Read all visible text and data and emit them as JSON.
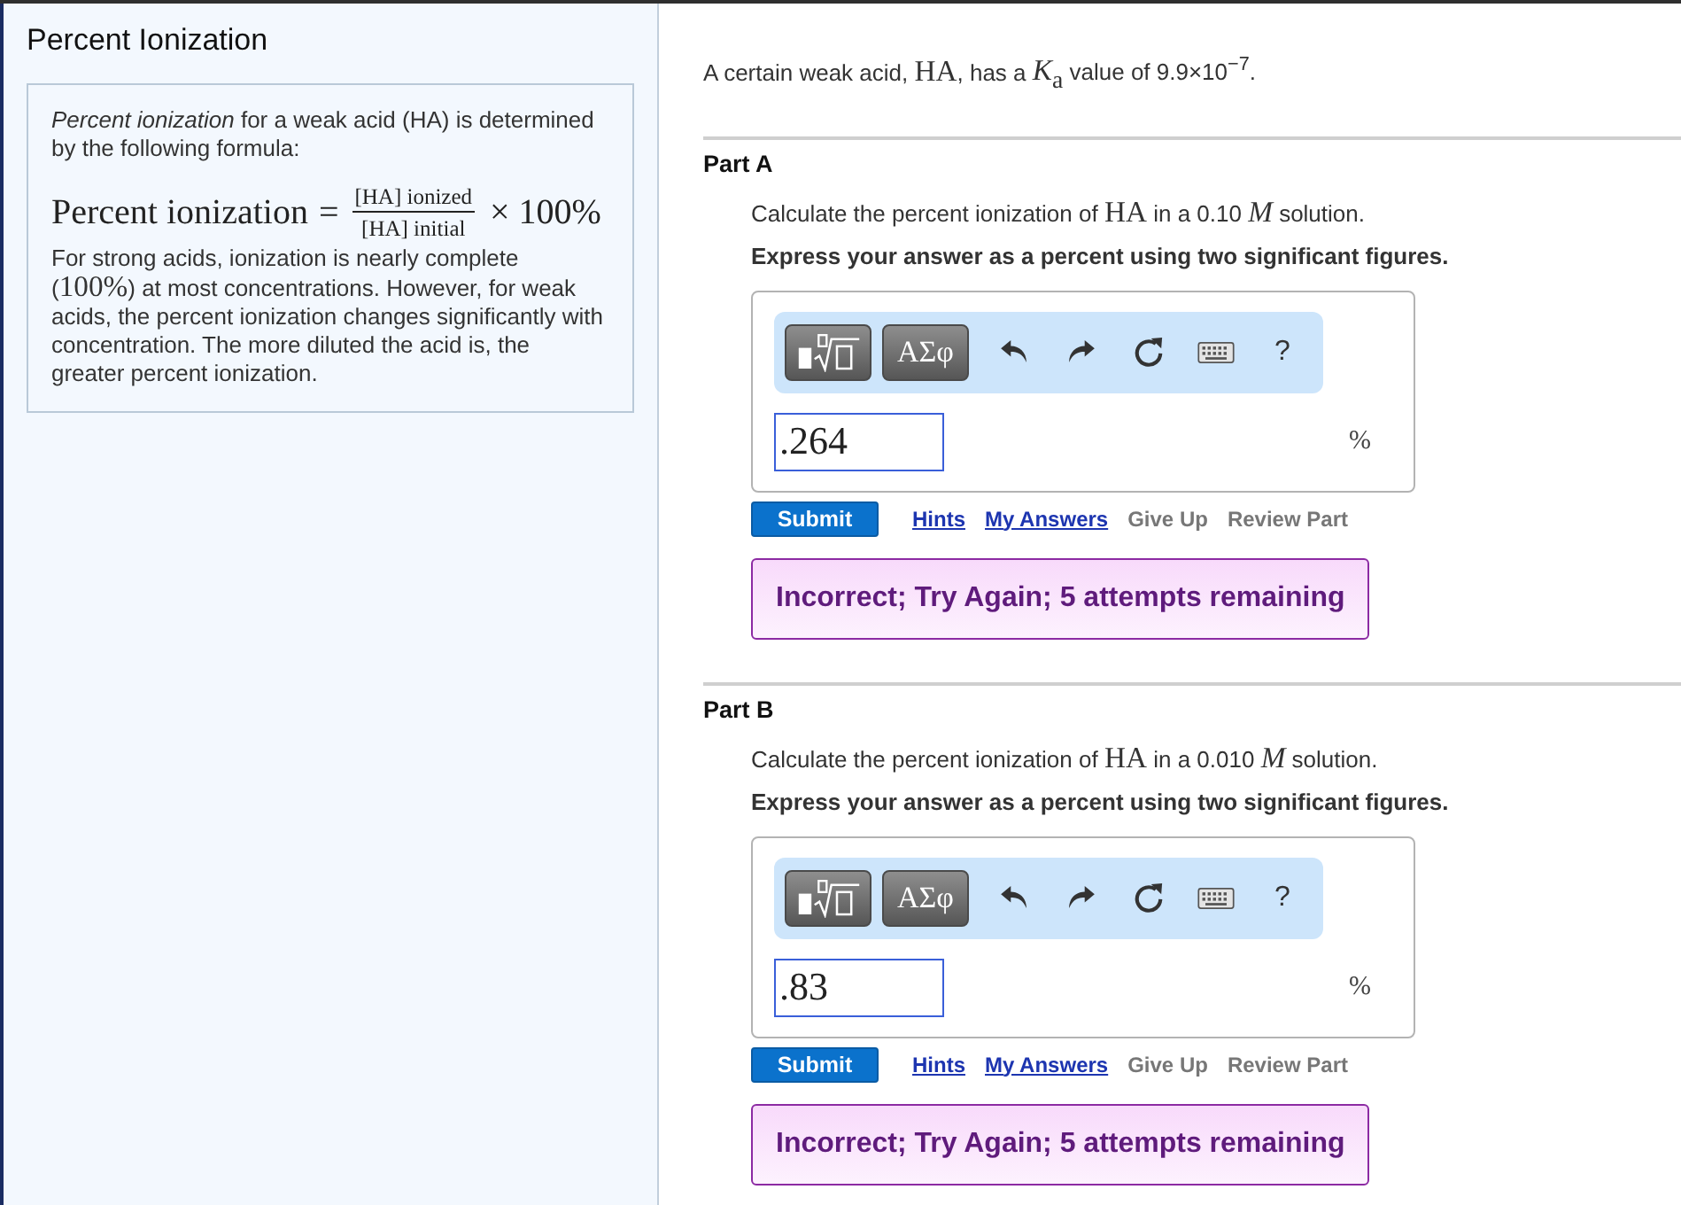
{
  "sidebar": {
    "title": "Percent Ionization",
    "card": {
      "intro": "*Percent ionization* for a weak acid (HA) is determined by the following formula:",
      "formula": {
        "lhs": "Percent ionization",
        "equals": "=",
        "numerator": "[HA] ionized",
        "denominator": "[HA] initial",
        "factor": "× 100%"
      },
      "paragraph": [
        {
          "kind": "text",
          "text": "For strong acids, ionization is nearly complete ("
        },
        {
          "kind": "math",
          "text": "100%"
        },
        {
          "kind": "text",
          "text": ") at most concentrations. However, for weak acids, the percent ionization changes significantly with concentration. The more diluted the acid is, the greater percent ionization."
        }
      ]
    }
  },
  "problem": {
    "statement": [
      {
        "kind": "text",
        "text": "A certain weak acid, "
      },
      {
        "kind": "math",
        "text": "HA"
      },
      {
        "kind": "text",
        "text": ", has a "
      },
      {
        "kind": "math",
        "text": "*K*$_{a}$"
      },
      {
        "kind": "text",
        "text": " value of 9.9×10$^{−7}$."
      }
    ]
  },
  "parts": [
    {
      "title": "Part A",
      "question": [
        {
          "kind": "text",
          "text": "Calculate the percent ionization of "
        },
        {
          "kind": "math",
          "text": "HA"
        },
        {
          "kind": "text",
          "text": " in a 0.10 "
        },
        {
          "kind": "math",
          "text": "*M*"
        },
        {
          "kind": "text",
          "text": " solution."
        }
      ],
      "instruction": "Express your answer as a percent using two significant figures.",
      "toolbar": [
        {
          "kind": "templates"
        },
        {
          "kind": "symbols",
          "label": "ΑΣφ"
        },
        {
          "kind": "undo"
        },
        {
          "kind": "redo"
        },
        {
          "kind": "reset"
        },
        {
          "kind": "keyboard"
        },
        {
          "kind": "help",
          "label": "?"
        }
      ],
      "answer": {
        "value": ".264",
        "unit": "%"
      },
      "submit": "Submit",
      "links": [
        {
          "kind": "link",
          "label": "Hints"
        },
        {
          "kind": "link",
          "label": "My Answers"
        },
        {
          "kind": "action",
          "label": "Give Up"
        },
        {
          "kind": "action",
          "label": "Review Part"
        }
      ],
      "feedback": "Incorrect; Try Again; 5 attempts remaining"
    },
    {
      "title": "Part B",
      "question": [
        {
          "kind": "text",
          "text": "Calculate the percent ionization of "
        },
        {
          "kind": "math",
          "text": "HA"
        },
        {
          "kind": "text",
          "text": " in a 0.010 "
        },
        {
          "kind": "math",
          "text": "*M*"
        },
        {
          "kind": "text",
          "text": " solution."
        }
      ],
      "instruction": "Express your answer as a percent using two significant figures.",
      "toolbar": [
        {
          "kind": "templates"
        },
        {
          "kind": "symbols",
          "label": "ΑΣφ"
        },
        {
          "kind": "undo"
        },
        {
          "kind": "redo"
        },
        {
          "kind": "reset"
        },
        {
          "kind": "keyboard"
        },
        {
          "kind": "help",
          "label": "?"
        }
      ],
      "answer": {
        "value": ".83",
        "unit": "%"
      },
      "submit": "Submit",
      "links": [
        {
          "kind": "link",
          "label": "Hints"
        },
        {
          "kind": "link",
          "label": "My Answers"
        },
        {
          "kind": "action",
          "label": "Give Up"
        },
        {
          "kind": "action",
          "label": "Review Part"
        }
      ],
      "feedback": "Incorrect; Try Again; 5 attempts remaining"
    }
  ]
}
